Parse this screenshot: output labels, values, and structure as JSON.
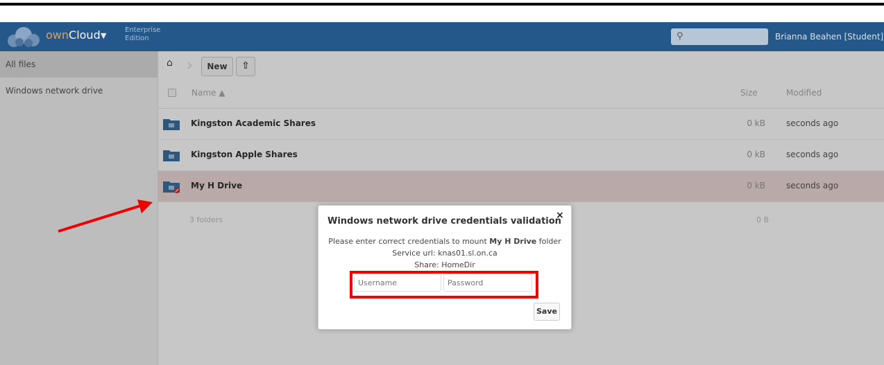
{
  "app": {
    "brand_own": "own",
    "brand_cloud": "Cloud",
    "edition_line1": "Enterprise",
    "edition_line2": "Edition",
    "user": "Brianna Beahen [Student] ▾"
  },
  "sidebar": {
    "items": [
      {
        "label": "All files",
        "active": true
      },
      {
        "label": "Windows network drive",
        "active": false
      }
    ]
  },
  "toolbar": {
    "new_label": "New",
    "upload_icon": "upload-icon",
    "home_icon": "home-icon"
  },
  "table": {
    "headers": {
      "name": "Name ▲",
      "size": "Size",
      "modified": "Modified"
    },
    "rows": [
      {
        "name": "Kingston Academic Shares",
        "size": "0 kB",
        "modified": "seconds ago"
      },
      {
        "name": "Kingston Apple Shares",
        "size": "0 kB",
        "modified": "seconds ago"
      },
      {
        "name": "My H Drive",
        "size": "0 kB",
        "modified": "seconds ago"
      }
    ],
    "summary": {
      "text": "3 folders",
      "size": "0 B"
    }
  },
  "dialog": {
    "title": "Windows network drive credentials validation",
    "msg_prefix": "Please enter correct credentials to mount ",
    "msg_bold": "My H Drive",
    "msg_suffix": " folder",
    "service_url": "Service url: knas01.sl.on.ca",
    "share": "Share: HomeDir",
    "username_placeholder": "Username",
    "password_placeholder": "Password",
    "save_label": "Save",
    "close_label": "×"
  },
  "colors": {
    "appbar": "#24588a",
    "highlight": "#ee0000",
    "selected_row": "#eed9d9"
  }
}
